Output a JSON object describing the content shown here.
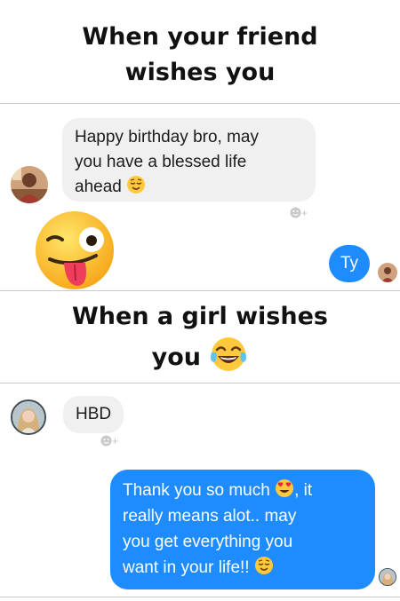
{
  "section1": {
    "caption_line1": "When your friend",
    "caption_line2": "wishes you",
    "incoming": {
      "line1": "Happy birthday bro, may",
      "line2": "you have a blessed life",
      "line3": "ahead"
    },
    "reply": "Ty",
    "react_plus": "+"
  },
  "section2": {
    "caption_line1": "When a girl wishes",
    "caption_line2": "you",
    "incoming": "HBD",
    "react_plus": "+",
    "reply": {
      "line1": "Thank you so much",
      "line1_tail": ", it",
      "line2": "really means alot.. may",
      "line3": "you get everything you",
      "line4": "want in your life!!"
    }
  },
  "colors": {
    "outgoing_bubble": "#1e8bff",
    "incoming_bubble": "#f0f0f0",
    "emoji_yellow": "#ffc83d"
  },
  "icons": {
    "avatar_friend": "avatar-friend",
    "avatar_girl": "avatar-girl",
    "wink_tongue": "winking-face-with-tongue-icon",
    "tears_of_joy": "face-with-tears-of-joy-icon",
    "relieved": "relieved-face-icon",
    "heart_eyes": "heart-eyes-face-icon",
    "reaction": "add-reaction-icon"
  }
}
